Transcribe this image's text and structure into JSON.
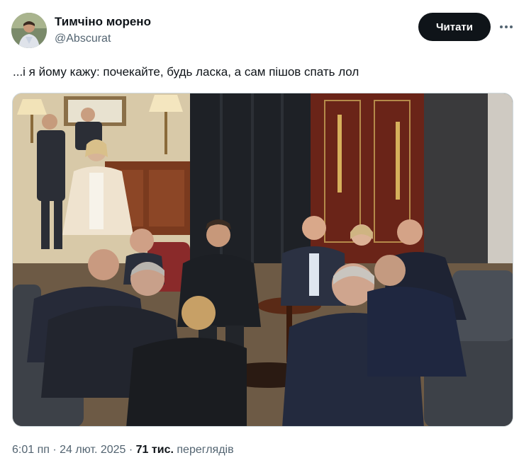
{
  "author": {
    "name": "Тимчіно морено",
    "handle": "@Abscurat"
  },
  "follow_button": {
    "label": "Читати"
  },
  "tweet": {
    "text": "...і я йому кажу: почекайте, будь ласка, а сам пішов спать лол"
  },
  "meta": {
    "time": "6:01 пп",
    "separator": "·",
    "date": "24 лют. 2025",
    "views_count": "71 тис.",
    "views_label": "переглядів"
  },
  "colors": {
    "text_primary": "#0f1419",
    "text_secondary": "#536471",
    "button_bg": "#0f1419",
    "button_text": "#ffffff",
    "border": "#cfd9de"
  },
  "icons": {
    "more": "more-horizontal-icon"
  }
}
